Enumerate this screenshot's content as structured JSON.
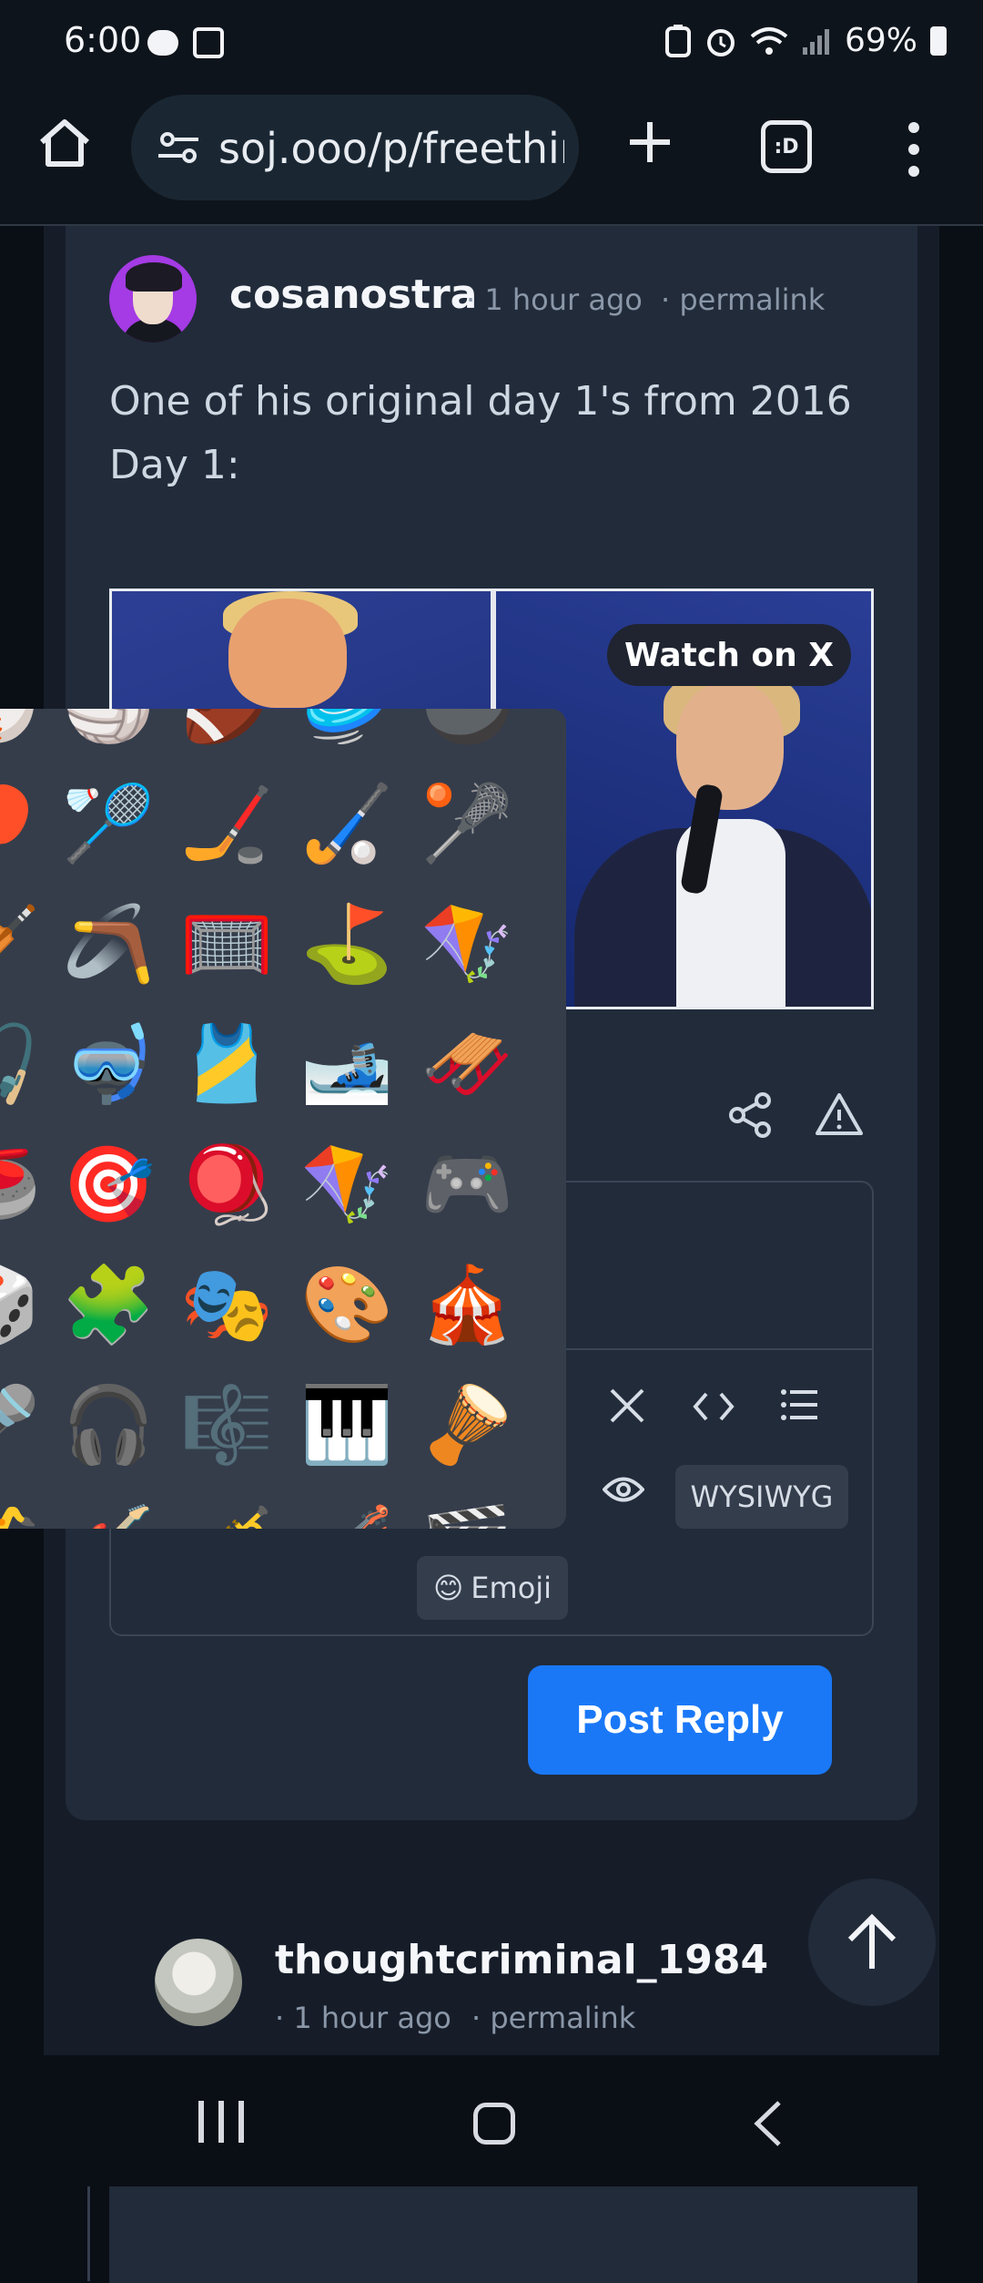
{
  "status_bar": {
    "time": "6:00",
    "battery": "69%",
    "icons": [
      "chat-bubble-icon",
      "image-icon",
      "battery-saver-icon",
      "alarm-icon",
      "wifi-icon",
      "signal-icon",
      "battery-icon"
    ]
  },
  "browser": {
    "url": "soj.ooo/p/freethir",
    "tabs_label": ":D",
    "icons": [
      "home-icon",
      "tune-icon",
      "plus-icon",
      "tabs-icon",
      "menu-icon"
    ]
  },
  "comment": {
    "username": "cosanostra",
    "time": "· 1 hour ago",
    "permalink": "· permalink",
    "body_line1": "One of his original day 1's from 2016",
    "body_line2": "Day 1:",
    "video_watch_label": "Watch on X"
  },
  "editor": {
    "wysiwyg_label": "WYSIWYG",
    "emoji_label": "Emoji",
    "emoji_icon": "😊",
    "post_reply_label": "Post Reply"
  },
  "emoji_picker": {
    "rows": [
      [
        "⚾",
        "🏐",
        "🏈",
        "🥏",
        "🎱"
      ],
      [
        "🏓",
        "🏸",
        "🏒",
        "🏑",
        "🥍"
      ],
      [
        "🏏",
        "🪃",
        "🥅",
        "⛳",
        "🪁"
      ],
      [
        "🎣",
        "🤿",
        "🎽",
        "🎿",
        "🛷"
      ],
      [
        "🥌",
        "🎯",
        "🪀",
        "🪁",
        "🎮"
      ],
      [
        "🎲",
        "🧩",
        "🎭",
        "🎨",
        "🎪"
      ],
      [
        "🎤",
        "🎧",
        "🎼",
        "🎹",
        "🪘"
      ],
      [
        "🎷",
        "🎸",
        "🎺",
        "🎻",
        "🎬"
      ]
    ]
  },
  "next_comment": {
    "username": "thoughtcriminal_1984",
    "time": "· 1 hour ago",
    "permalink": "· permalink"
  }
}
